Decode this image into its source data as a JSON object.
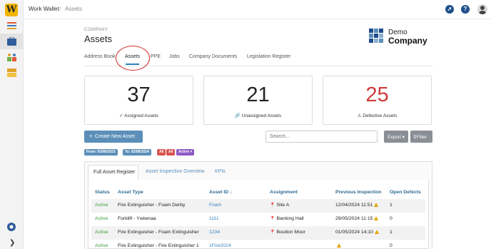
{
  "app": {
    "logo_letter": "W",
    "name": "Work Wallet",
    "breadcrumb_sep": "/",
    "breadcrumb_page": "Assets"
  },
  "topbar": {
    "rocket_icon": "rocket-icon",
    "help_label": "?",
    "avatar_icon": "avatar"
  },
  "header": {
    "company_label": "COMPANY",
    "title": "Assets",
    "brand_line1": "Demo",
    "brand_line2": "Company"
  },
  "tabs": [
    {
      "label": "Address Book"
    },
    {
      "label": "Assets"
    },
    {
      "label": "PPE"
    },
    {
      "label": "Jobs"
    },
    {
      "label": "Company Documents"
    },
    {
      "label": "Legislation Register"
    }
  ],
  "stats": [
    {
      "value": "37",
      "label": "✓ Assigned Assets"
    },
    {
      "value": "21",
      "label": "🔗 Unassigned Assets"
    },
    {
      "value": "25",
      "label": "⚠ Defective Assets",
      "color": "#d03a3a"
    }
  ],
  "toolbar": {
    "create_label": "Create New Asset",
    "search_placeholder": "Search...",
    "export_label": "Export ▾",
    "filter_label": "⚲Filter"
  },
  "filters": [
    {
      "label": "From: 03/08/2023",
      "color": "#5b8fb9"
    },
    {
      "label": "To: 02/08/2024",
      "color": "#5b8fb9"
    },
    {
      "label": "All",
      "color": "#d9534f"
    },
    {
      "label": "All",
      "color": "#d9534f"
    },
    {
      "label": "Active ×",
      "color": "#8e5ac4"
    }
  ],
  "register": {
    "tabs": [
      "Full Asset Register",
      "Asset Inspection Overview",
      "KPIs"
    ],
    "columns": [
      "Status",
      "Asset Type",
      "Asset ID ↓",
      "Assignment",
      "Previous Inspection",
      "Open Defects"
    ],
    "rows": [
      {
        "status": "Active",
        "type": "Fire Extinguisher - Foam Derby",
        "id": "Foam",
        "assignment": "Site A",
        "inspection": "12/04/2024 11:51",
        "defects": "1"
      },
      {
        "status": "Active",
        "type": "Forklift - Ywiwnaa",
        "id": "1111",
        "assignment": "Banking Hall",
        "inspection": "29/05/2024 11:15",
        "defects": "0"
      },
      {
        "status": "Active",
        "type": "Fire Extinguisher - Foam Extinguisher",
        "id": "1234",
        "assignment": "Boulton Moor",
        "inspection": "01/05/2024 14:10",
        "defects": "1"
      },
      {
        "status": "Active",
        "type": "Fire Extinguisher - Fire Extinguisher 1",
        "id": "1Fire2024",
        "assignment": "",
        "inspection": "",
        "defects": "0"
      }
    ]
  },
  "colors": {
    "accent": "#5b8fb9",
    "link": "#3b83c0",
    "status_active": "#3a9b3a",
    "danger": "#d03a3a",
    "annotation": "#d62a2a"
  }
}
